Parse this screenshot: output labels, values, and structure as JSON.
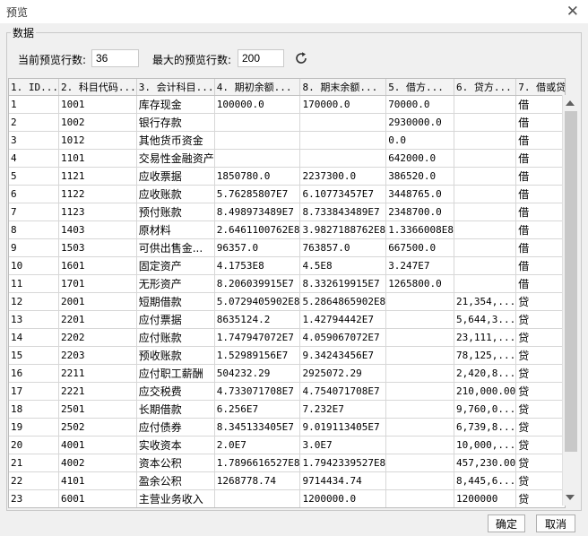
{
  "window": {
    "title": "预览",
    "close_glyph": "✕"
  },
  "group": {
    "label": "数据"
  },
  "controls": {
    "current_rows_label": "当前预览行数:",
    "current_rows_value": "36",
    "max_rows_label": "最大的预览行数:",
    "max_rows_value": "200"
  },
  "table": {
    "columns": [
      "1. ID...",
      "2. 科目代码...",
      "3. 会计科目...",
      "4. 期初余额...",
      "8. 期末余额...",
      "5. 借方...",
      "6. 贷方...",
      "7. 借或贷..."
    ],
    "rows": [
      [
        "1",
        "1001",
        "库存现金",
        "100000.0",
        "170000.0",
        "70000.0",
        "",
        "借"
      ],
      [
        "2",
        "1002",
        "银行存款",
        "",
        "",
        "2930000.0",
        "",
        "借"
      ],
      [
        "3",
        "1012",
        "其他货币资金",
        "",
        "",
        "0.0",
        "",
        "借"
      ],
      [
        "4",
        "1101",
        "交易性金融资产",
        "",
        "",
        "642000.0",
        "",
        "借"
      ],
      [
        "5",
        "1121",
        "应收票据",
        "1850780.0",
        "2237300.0",
        "386520.0",
        "",
        "借"
      ],
      [
        "6",
        "1122",
        "应收账款",
        "5.76285807E7",
        "6.10773457E7",
        "3448765.0",
        "",
        "借"
      ],
      [
        "7",
        "1123",
        "预付账款",
        "8.498973489E7",
        "8.733843489E7",
        "2348700.0",
        "",
        "借"
      ],
      [
        "8",
        "1403",
        "原材料",
        "2.6461100762E8",
        "3.9827188762E8",
        "1.3366008E8",
        "",
        "借"
      ],
      [
        "9",
        "1503",
        "可供出售金...",
        "96357.0",
        "763857.0",
        "667500.0",
        "",
        "借"
      ],
      [
        "10",
        "1601",
        "固定资产",
        "4.1753E8",
        "4.5E8",
        "3.247E7",
        "",
        "借"
      ],
      [
        "11",
        "1701",
        "无形资产",
        "8.206039915E7",
        "8.332619915E7",
        "1265800.0",
        "",
        "借"
      ],
      [
        "12",
        "2001",
        "短期借款",
        "5.0729405902E8",
        "5.2864865902E8",
        "",
        "21,354,...",
        "贷"
      ],
      [
        "13",
        "2201",
        "应付票据",
        "8635124.2",
        "1.42794442E7",
        "",
        "5,644,3...",
        "贷"
      ],
      [
        "14",
        "2202",
        "应付账款",
        "1.747947072E7",
        "4.059067072E7",
        "",
        "23,111,...",
        "贷"
      ],
      [
        "15",
        "2203",
        "预收账款",
        "1.52989156E7",
        "9.34243456E7",
        "",
        "78,125,...",
        "贷"
      ],
      [
        "16",
        "2211",
        "应付职工薪酬",
        "504232.29",
        "2925072.29",
        "",
        "2,420,8...",
        "贷"
      ],
      [
        "17",
        "2221",
        "应交税费",
        "4.733071708E7",
        "4.754071708E7",
        "",
        "210,000.00",
        "贷"
      ],
      [
        "18",
        "2501",
        "长期借款",
        "6.256E7",
        "7.232E7",
        "",
        "9,760,0...",
        "贷"
      ],
      [
        "19",
        "2502",
        "应付债券",
        "8.345133405E7",
        "9.019113405E7",
        "",
        "6,739,8...",
        "贷"
      ],
      [
        "20",
        "4001",
        "实收资本",
        "2.0E7",
        "3.0E7",
        "",
        "10,000,...",
        "贷"
      ],
      [
        "21",
        "4002",
        "资本公积",
        "1.7896616527E8",
        "1.7942339527E8",
        "",
        "457,230.00",
        "贷"
      ],
      [
        "22",
        "4101",
        "盈余公积",
        "1268778.74",
        "9714434.74",
        "",
        "8,445,6...",
        "贷"
      ],
      [
        "23",
        "6001",
        "主营业务收入",
        "",
        "1200000.0",
        "",
        "1200000",
        "贷"
      ]
    ]
  },
  "buttons": {
    "ok": "确定",
    "cancel": "取消"
  },
  "icons": {
    "refresh": "refresh-icon",
    "close": "close-icon"
  }
}
